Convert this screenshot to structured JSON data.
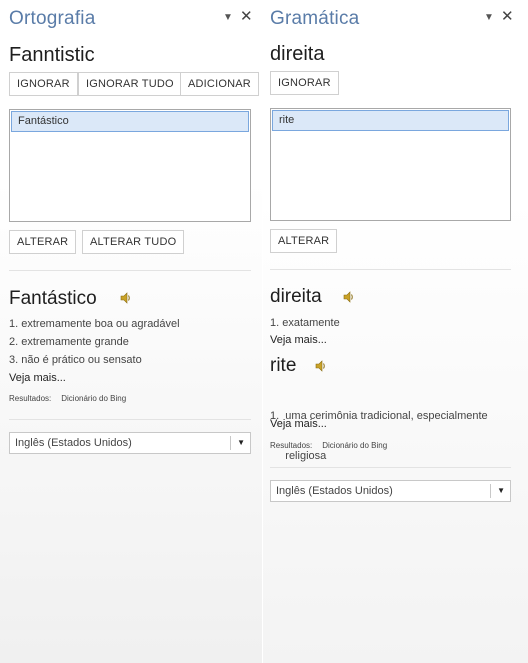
{
  "spelling": {
    "title": "Ortografia",
    "word": "Fanntistic",
    "buttons": {
      "ignore": "IGNORAR",
      "ignore_all": "IGNORAR TUDO",
      "add": "ADICIONAR",
      "change": "ALTERAR",
      "change_all": "ALTERAR TUDO"
    },
    "suggestions": [
      "Fantástico"
    ],
    "definition": {
      "word": "Fantástico",
      "items": [
        "1. extremamente boa ou agradável",
        "2. extremamente grande",
        "3. não é prático ou sensato"
      ],
      "more": "Veja mais...",
      "results_label": "Resultados:",
      "results_source": "Dicionário do Bing"
    },
    "language": "Inglês (Estados Unidos)"
  },
  "grammar": {
    "title": "Gramática",
    "word": "direita",
    "buttons": {
      "ignore": "IGNORAR",
      "change": "ALTERAR"
    },
    "suggestions": [
      "rite"
    ],
    "definitions": [
      {
        "word": "direita",
        "items": [
          "1. exatamente"
        ],
        "more": "Veja mais..."
      },
      {
        "word": "rite",
        "items": [
          "1.  uma cerimônia tradicional, especialmente",
          "     religiosa"
        ],
        "more": "Veja mais..."
      }
    ],
    "results_label": "Resultados:",
    "results_source": "Dicionário do Bing",
    "language": "Inglês (Estados Unidos)"
  },
  "icons": {
    "menu": "chevron-down-icon",
    "close": "close-icon",
    "speaker": "speaker-icon",
    "dropdown": "caret-down-icon"
  },
  "colors": {
    "title": "#5a7ca8",
    "selection_bg": "#dbe8f8",
    "selection_border": "#7aa7de"
  }
}
